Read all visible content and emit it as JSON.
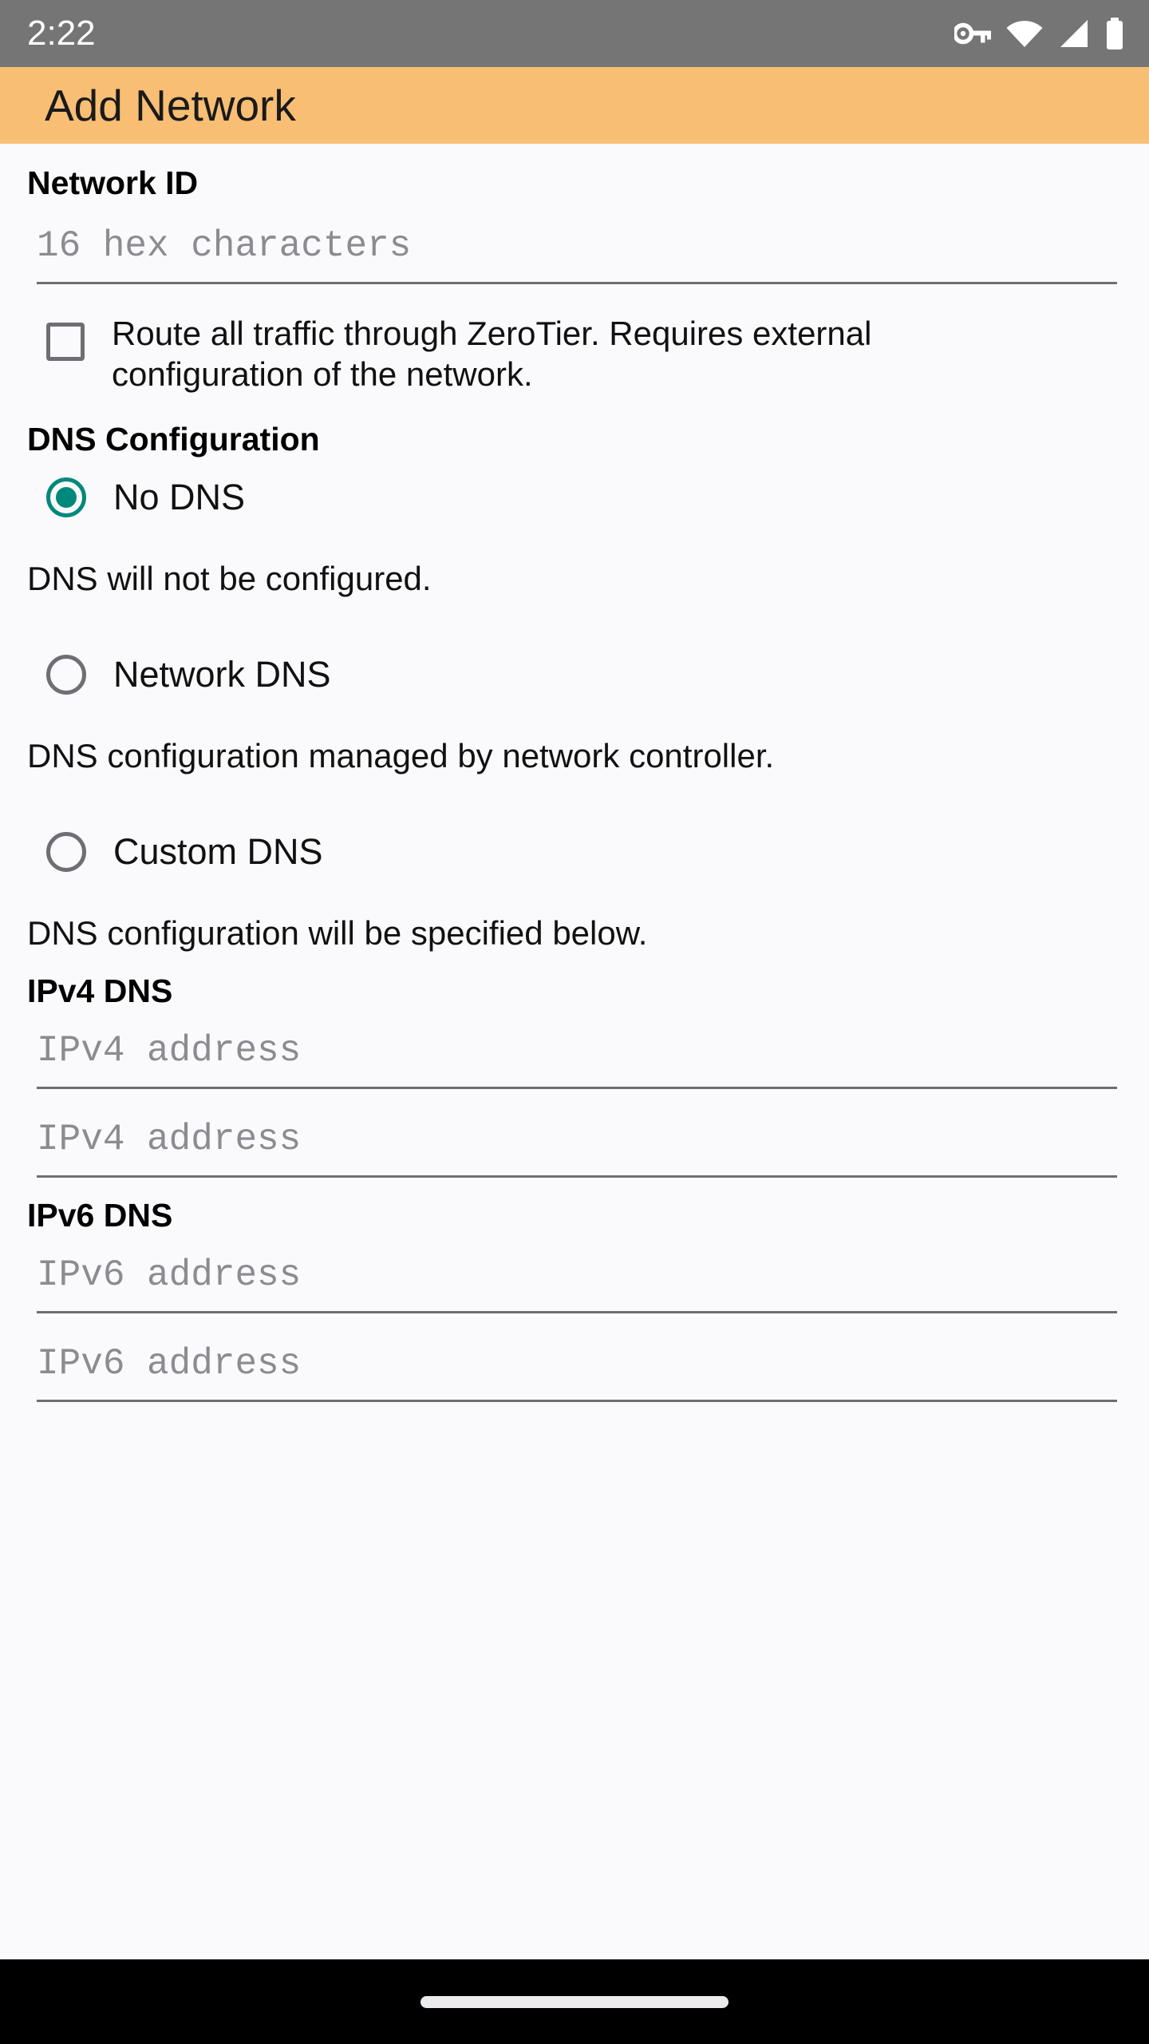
{
  "status_bar": {
    "time": "2:22",
    "icons": [
      "vpn-key-icon",
      "wifi-icon",
      "signal-cellular-icon",
      "battery-icon"
    ],
    "background": "#757575"
  },
  "app_bar": {
    "title": "Add Network",
    "background": "#F8BE74",
    "text_color": "#1A1A1A"
  },
  "form": {
    "network_id": {
      "label": "Network ID",
      "placeholder": "16 hex characters",
      "value": ""
    },
    "route_all_traffic": {
      "label": "Route all traffic through ZeroTier. Requires external configuration of the network.",
      "checked": false
    },
    "dns_configuration": {
      "label": "DNS Configuration",
      "selected": "No DNS",
      "accent_color": "#00897B",
      "options": [
        {
          "label": "No DNS",
          "description": "DNS will not be configured.",
          "selected": true
        },
        {
          "label": "Network DNS",
          "description": "DNS configuration managed by network controller.",
          "selected": false
        },
        {
          "label": "Custom DNS",
          "description": "DNS configuration will be specified below.",
          "selected": false
        }
      ]
    },
    "ipv4_dns": {
      "label": "IPv4 DNS",
      "fields": [
        {
          "placeholder": "IPv4 address",
          "value": ""
        },
        {
          "placeholder": "IPv4 address",
          "value": ""
        }
      ]
    },
    "ipv6_dns": {
      "label": "IPv6 DNS",
      "fields": [
        {
          "placeholder": "IPv6 address",
          "value": ""
        },
        {
          "placeholder": "IPv6 address",
          "value": ""
        }
      ]
    }
  },
  "nav_bar": {
    "gesture_pill": "home-gesture-pill",
    "background": "#000000"
  }
}
